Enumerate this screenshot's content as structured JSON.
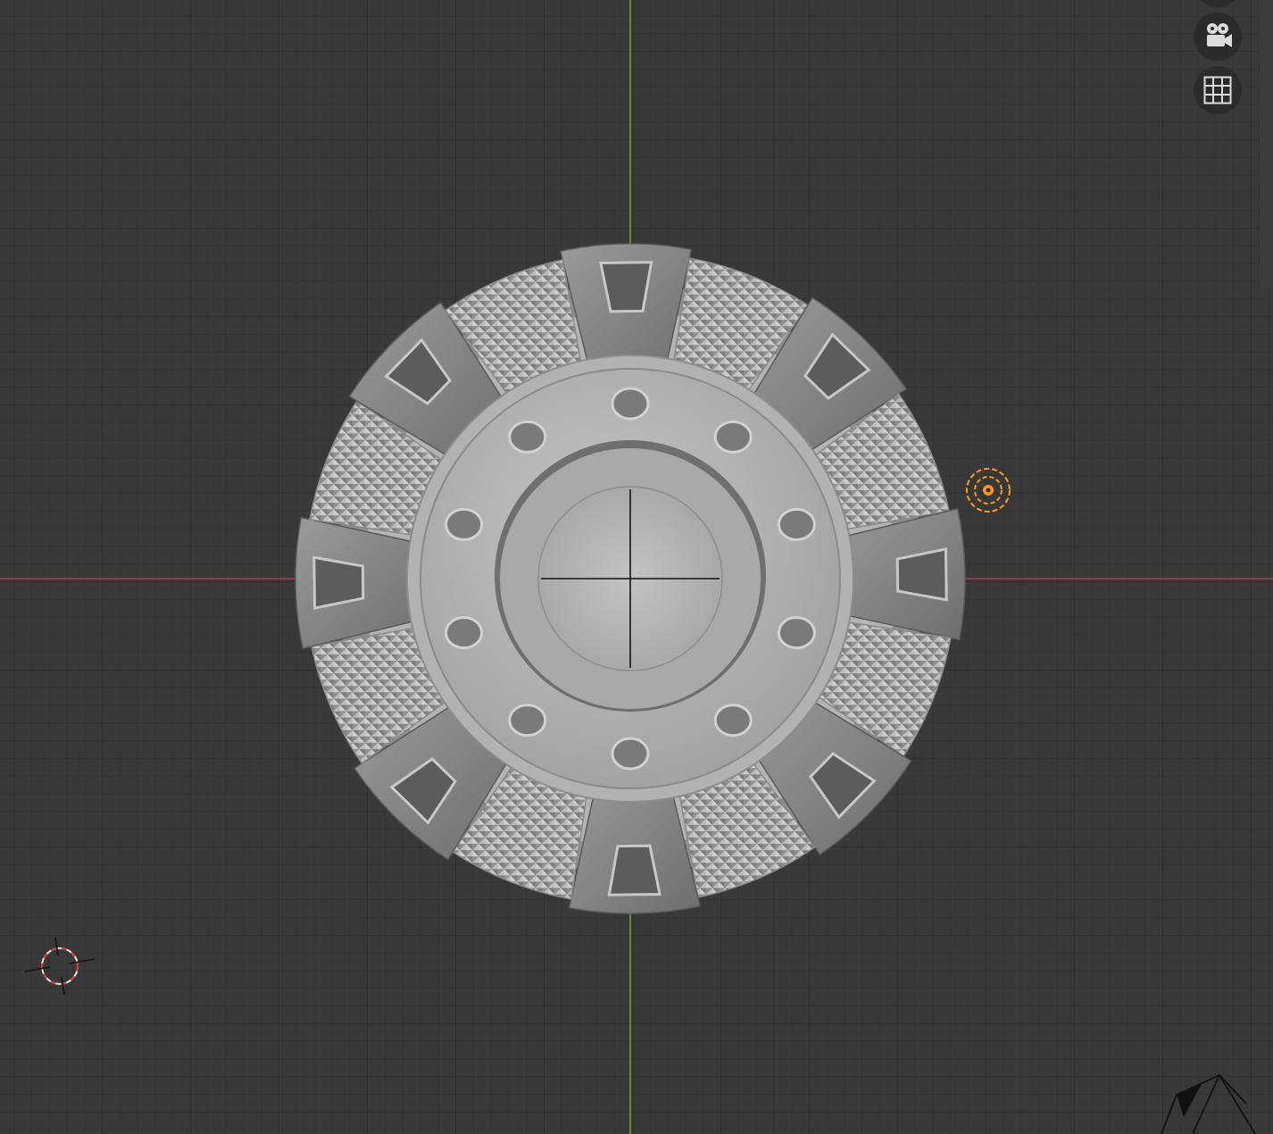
{
  "app": "3D Viewport",
  "viewport": {
    "background": "#393939",
    "axis_x_color": "#8b3a4a",
    "axis_y_color": "#6a8b2c"
  },
  "navigation_gizmo": {
    "buttons": [
      {
        "icon": "camera-view-icon"
      },
      {
        "icon": "orthographic-grid-icon"
      }
    ]
  },
  "scene_objects": {
    "mesh": "gear-wheel-mesh",
    "light": {
      "icon": "point-light-icon",
      "color": "#ff9a1f"
    },
    "cursor": {
      "icon": "3d-cursor-icon"
    },
    "camera": {
      "icon": "camera-object-icon"
    }
  }
}
